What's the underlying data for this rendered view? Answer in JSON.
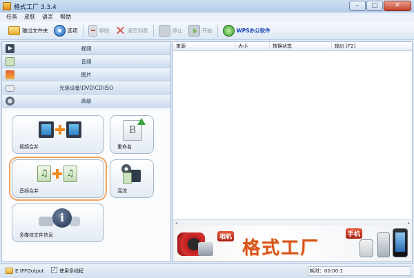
{
  "window": {
    "title": "格式工厂 3.3.4",
    "controls": {
      "minimize": "–",
      "maximize": "□",
      "close": "✕"
    }
  },
  "menu": {
    "items": [
      "任务",
      "皮肤",
      "语言",
      "帮助"
    ]
  },
  "toolbar": {
    "output_folder": "输出文件夹",
    "options": "选项",
    "remove": "移除",
    "clear_list": "清空列表",
    "stop": "停止",
    "start": "开始",
    "wps": "WPS办公软件"
  },
  "sidebar": {
    "categories": [
      "视频",
      "音频",
      "图片",
      "光驱设备\\DVD\\CD\\ISO",
      "高级"
    ],
    "tools": [
      {
        "label": "视频合并",
        "icon": "video-merge-icon"
      },
      {
        "label": "重命名",
        "icon": "rename-icon"
      },
      {
        "label": "音频合并",
        "icon": "audio-merge-icon"
      },
      {
        "label": "混流",
        "icon": "mux-icon"
      },
      {
        "label": "多媒体文件信息",
        "icon": "media-info-icon"
      }
    ],
    "selected_tool": "音频合并",
    "accent_color": "#f2a35f"
  },
  "task_list": {
    "columns": [
      "来源",
      "大小",
      "转换状态",
      "输出 [F2]"
    ],
    "rows": []
  },
  "banner": {
    "title": "格式工厂",
    "camera_tag": "相机",
    "phone_tag": "手机"
  },
  "status": {
    "output_path": "E:\\FFOutput",
    "multithread_checked": true,
    "multithread_label": "使用多线程",
    "elapsed": "耗时：00:00:1"
  }
}
